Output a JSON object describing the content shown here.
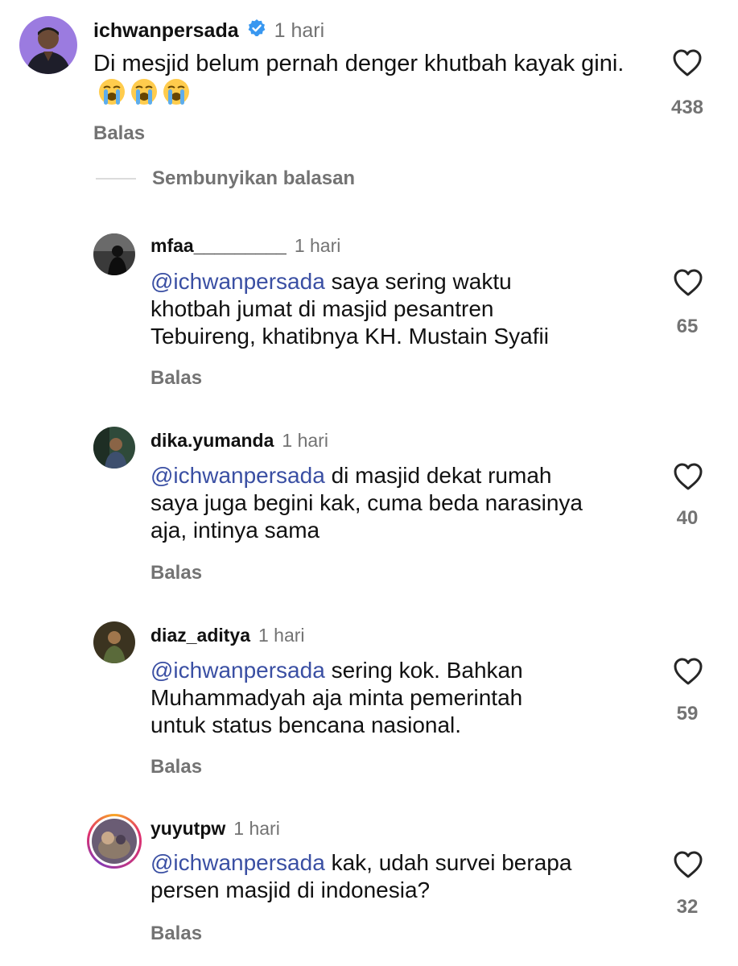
{
  "parent_comment": {
    "username": "ichwanpersada",
    "time": "1 hari",
    "text": "Di mesjid belum pernah denger khutbah kayak gini.",
    "emojis": [
      "😭",
      "😭",
      "😭"
    ],
    "reply_label": "Balas",
    "like_count": "438",
    "avatar_icon": "profile-photo"
  },
  "hide_replies_label": "Sembunyikan balasan",
  "replies": [
    {
      "username": "mfaa_________",
      "time": "1 hari",
      "mention": "@ichwanpersada",
      "text_line1": "saya sering waktu",
      "text_line2": "khotbah jumat di masjid pesantren",
      "text_line3": "Tebuireng, khatibnya KH. Mustain Syafii",
      "reply_label": "Balas",
      "like_count": "65"
    },
    {
      "username": "dika.yumanda",
      "time": "1 hari",
      "mention": "@ichwanpersada",
      "text_line1": "di masjid dekat rumah",
      "text_line2": "saya juga begini kak, cuma beda narasinya",
      "text_line3": "aja, intinya sama",
      "reply_label": "Balas",
      "like_count": "40"
    },
    {
      "username": "diaz_aditya",
      "time": "1 hari",
      "mention": "@ichwanpersada",
      "text_line1": "sering kok. Bahkan",
      "text_line2": "Muhammadyah aja minta pemerintah",
      "text_line3": "untuk status bencana nasional.",
      "reply_label": "Balas",
      "like_count": "59"
    },
    {
      "username": "yuyutpw",
      "time": "1 hari",
      "mention": "@ichwanpersada",
      "text_line1": "kak, udah survei berapa",
      "text_line2": "persen masjid di indonesia?",
      "reply_label": "Balas",
      "like_count": "32"
    }
  ],
  "colors": {
    "mention": "#3a4fa3",
    "muted": "#737373",
    "verified": "#3897f0",
    "story_ring_start": "#f9a825",
    "story_ring_end": "#c13584"
  }
}
